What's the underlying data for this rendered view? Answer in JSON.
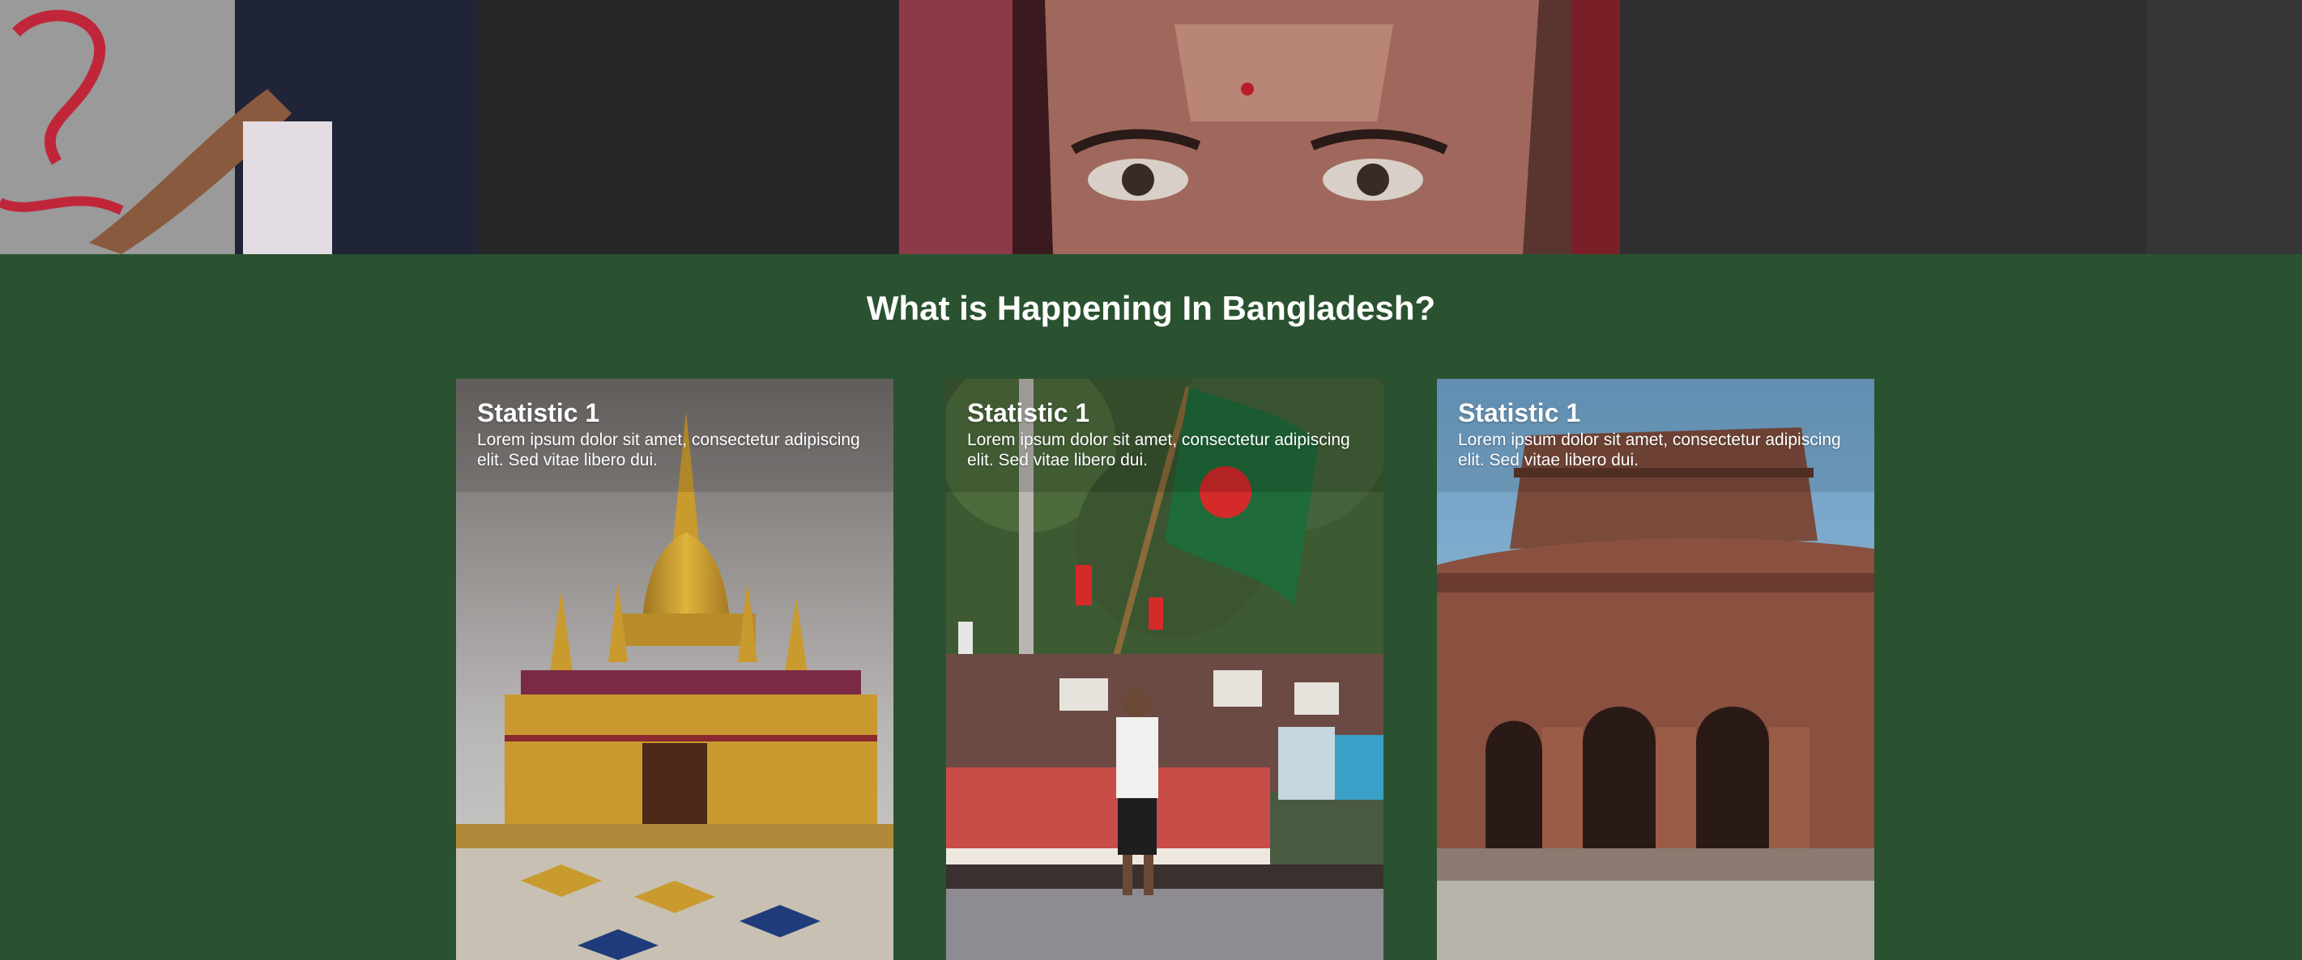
{
  "section": {
    "title": "What is Happening In Bangladesh?"
  },
  "cards": [
    {
      "title": "Statistic 1",
      "description": "Lorem ipsum dolor sit amet, consectetur adipiscing elit. Sed vitae libero dui.",
      "image": "golden-pagoda-temple-photo"
    },
    {
      "title": "Statistic 1",
      "description": "Lorem ipsum dolor sit amet, consectetur adipiscing elit. Sed vitae libero dui.",
      "image": "protest-flag-photo"
    },
    {
      "title": "Statistic 1",
      "description": "Lorem ipsum dolor sit amet, consectetur adipiscing elit. Sed vitae libero dui.",
      "image": "terracotta-temple-photo"
    }
  ],
  "colors": {
    "section_background": "#2a5230",
    "heading_text": "#ffffff",
    "card_text": "#ffffff"
  }
}
